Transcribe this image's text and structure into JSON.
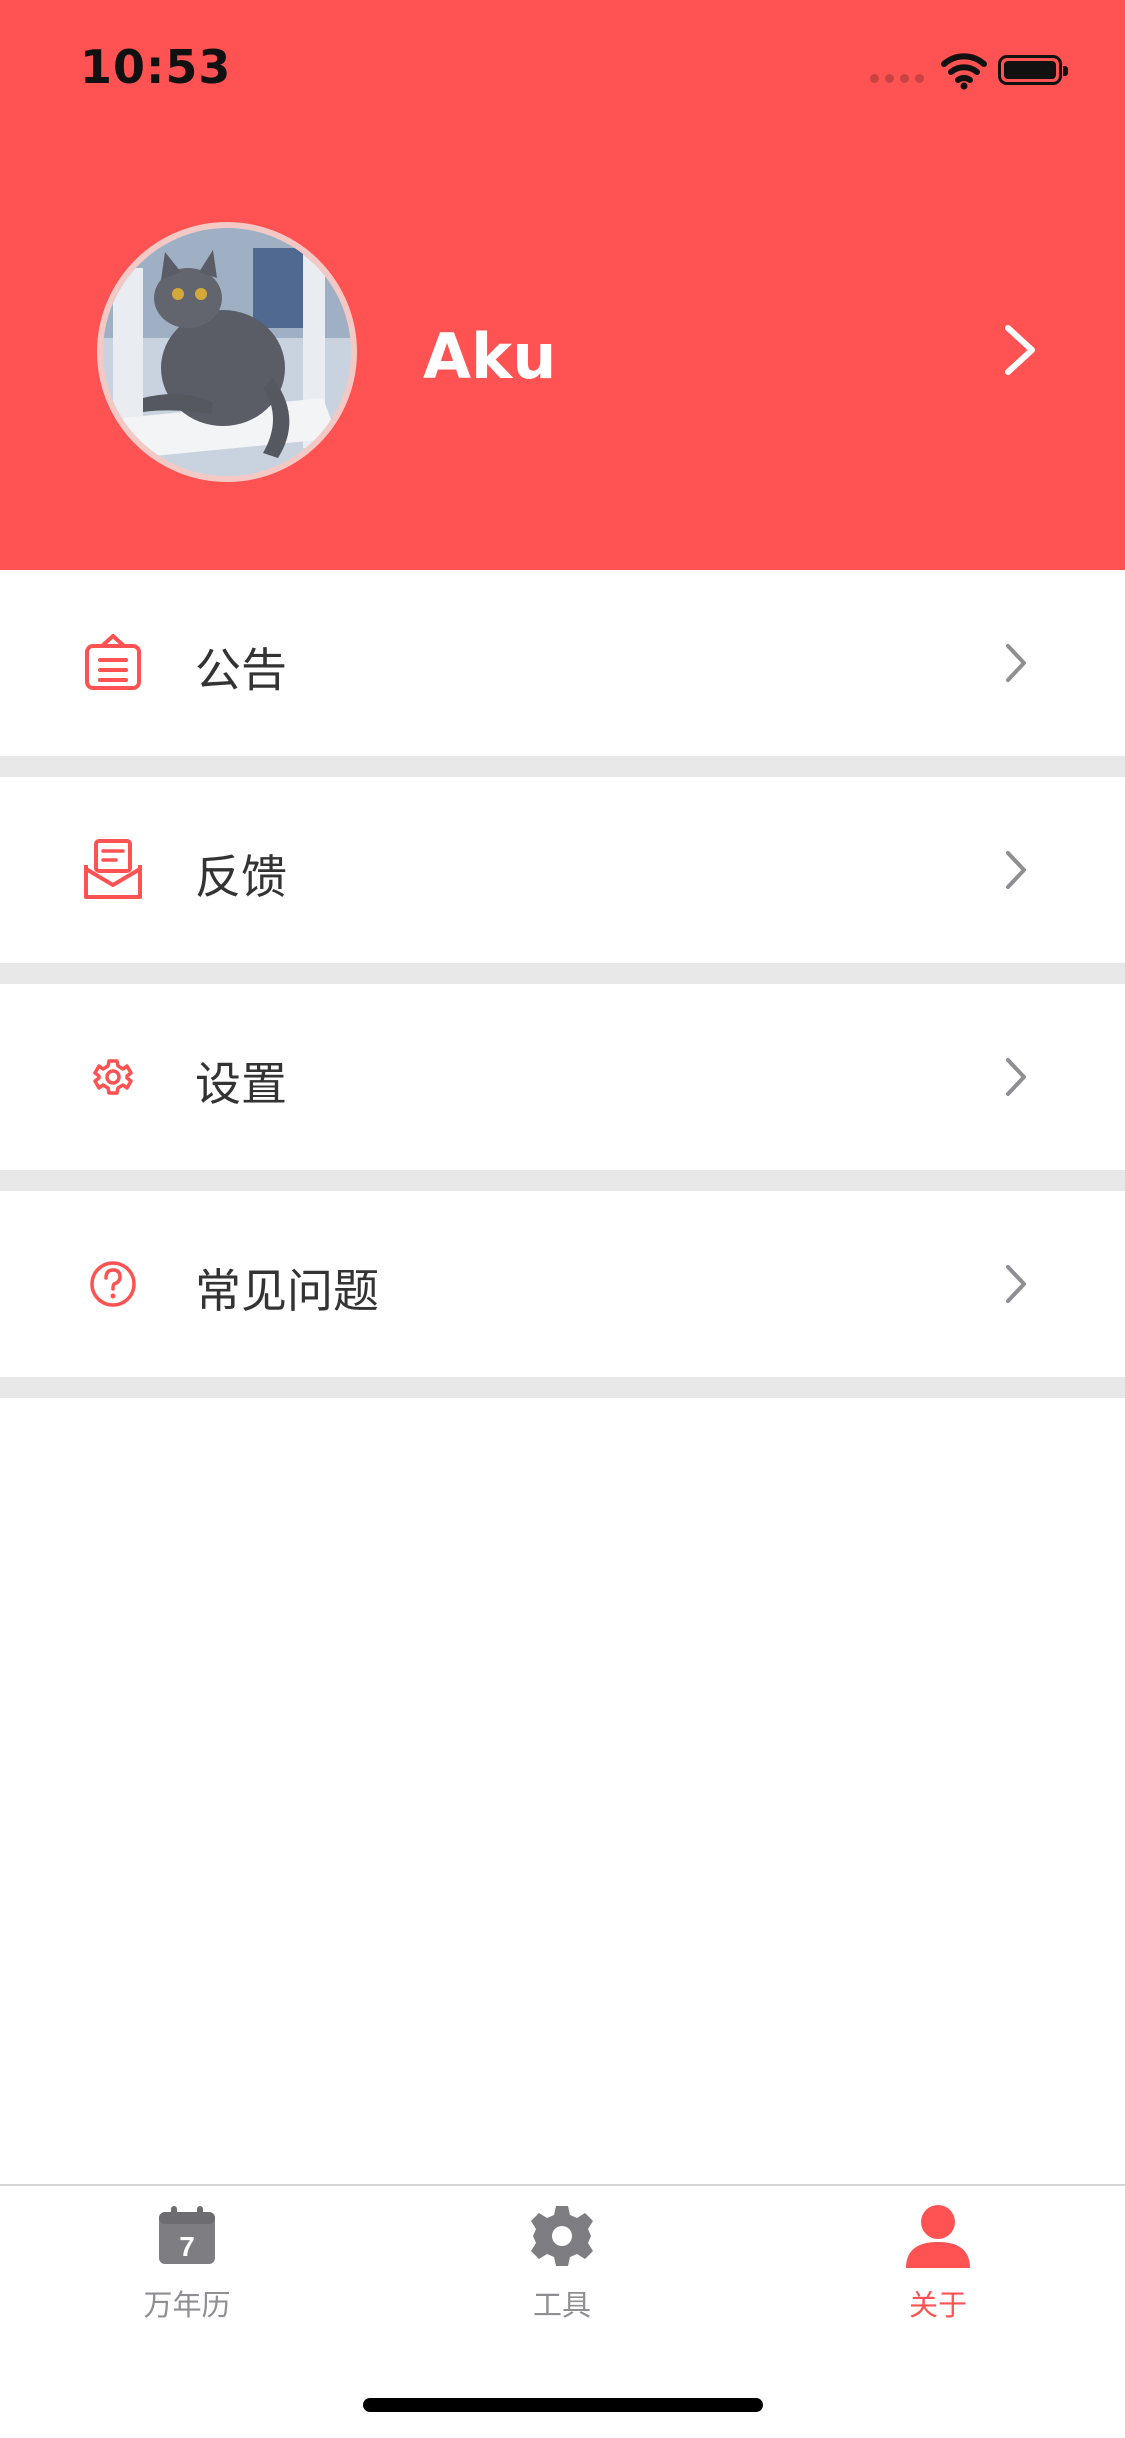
{
  "status_bar": {
    "time": "10:53"
  },
  "profile": {
    "name": "Aku",
    "avatar_icon": "cat-photo-avatar"
  },
  "menu": {
    "items": [
      {
        "label": "公告",
        "icon": "announcement-icon"
      },
      {
        "label": "反馈",
        "icon": "feedback-mail-icon"
      },
      {
        "label": "设置",
        "icon": "gear-icon"
      },
      {
        "label": "常见问题",
        "icon": "question-circle-icon"
      }
    ]
  },
  "tabbar": {
    "tabs": [
      {
        "label": "万年历",
        "icon": "calendar-icon",
        "calendar_day": "7",
        "active": false
      },
      {
        "label": "工具",
        "icon": "gear-icon",
        "active": false
      },
      {
        "label": "关于",
        "icon": "person-icon",
        "active": true
      }
    ]
  },
  "colors": {
    "accent": "#FF5252",
    "separator": "#e8e8e8",
    "inactive_tab": "#8e8e93"
  }
}
